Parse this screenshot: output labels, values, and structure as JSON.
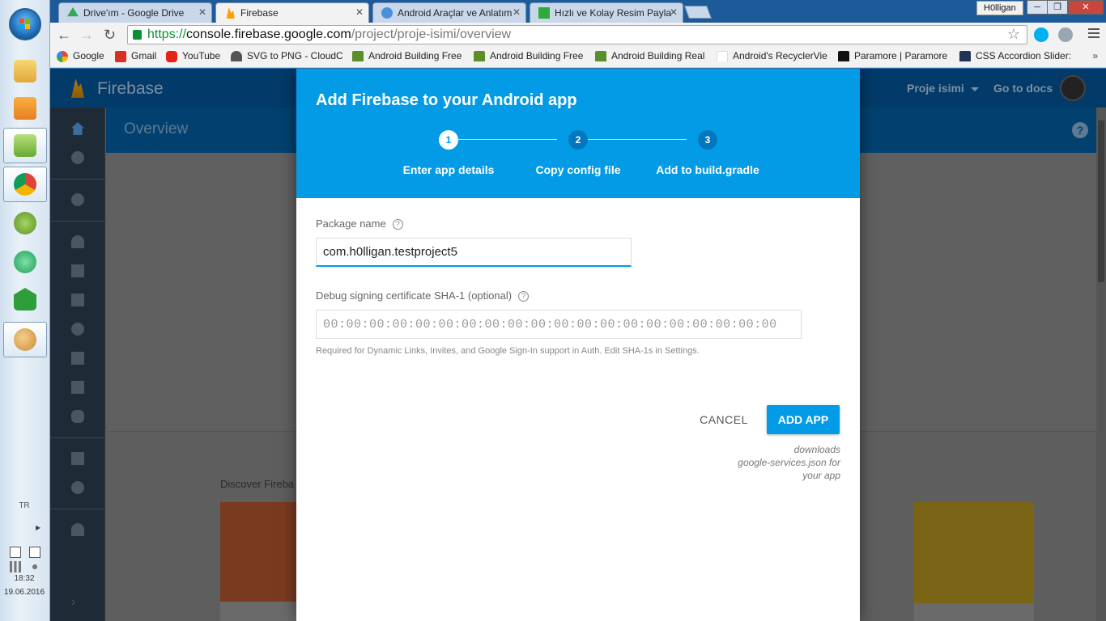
{
  "taskbar": {
    "apps": [
      {
        "name": "file-explorer"
      },
      {
        "name": "media-player"
      },
      {
        "name": "notepad-plus-plus"
      },
      {
        "name": "chrome"
      },
      {
        "name": "android-studio"
      },
      {
        "name": "atom"
      },
      {
        "name": "mapping-app"
      },
      {
        "name": "paint"
      }
    ],
    "language": "TR",
    "clock_time": "18:32",
    "clock_date": "19.06.2016"
  },
  "browser": {
    "profile": "H0lligan",
    "tabs": [
      {
        "label": "Drive'ım - Google Drive",
        "favicon_color": "#34a853"
      },
      {
        "label": "Firebase",
        "favicon_color": "#ffa000"
      },
      {
        "label": "Android Araçlar ve Anlatım",
        "favicon_color": "#4a90d9"
      },
      {
        "label": "Hızlı ve Kolay Resim Payla",
        "favicon_color": "#2eaa3a"
      }
    ],
    "url_scheme": "https://",
    "url_host": "console.firebase.google.com",
    "url_path": "/project/proje-isimi/overview",
    "bookmarks": [
      {
        "label": "Google",
        "color": "#4285f4"
      },
      {
        "label": "Gmail",
        "color": "#d93025"
      },
      {
        "label": "YouTube",
        "color": "#e62117"
      },
      {
        "label": "SVG to PNG - CloudC",
        "color": "#555555"
      },
      {
        "label": "Android Building Free",
        "color": "#5a8f29"
      },
      {
        "label": "Android Building Free",
        "color": "#5a8f29"
      },
      {
        "label": "Android Building Real",
        "color": "#5a8f29"
      },
      {
        "label": "Android's RecyclerVie",
        "color": "#ffffff"
      },
      {
        "label": "Paramore | Paramore",
        "color": "#111111"
      },
      {
        "label": "CSS Accordion Slider:",
        "color": "#223355"
      }
    ],
    "bookmarks_more": "»"
  },
  "firebase": {
    "brand": "Firebase",
    "project": "Proje isimi",
    "docs": "Go to docs",
    "page_title": "Overview",
    "help": "?",
    "discover": "Discover Fireba",
    "nav_icons": [
      "home-icon",
      "settings-icon",
      "analytics-icon",
      "users-icon",
      "database-icon",
      "storage-icon",
      "hosting-icon",
      "remote-config-icon",
      "test-lab-icon",
      "crash-icon",
      "notifications-icon",
      "dynamic-links-icon",
      "admob-icon",
      "expand-icon"
    ]
  },
  "modal": {
    "title": "Add Firebase to your Android app",
    "steps": [
      {
        "number": "1",
        "label": "Enter app details"
      },
      {
        "number": "2",
        "label": "Copy config file"
      },
      {
        "number": "3",
        "label": "Add to build.gradle"
      }
    ],
    "package_label": "Package name",
    "package_value": "com.h0lligan.testproject5",
    "sha_label": "Debug signing certificate SHA-1 (optional)",
    "sha_placeholder": "00:00:00:00:00:00:00:00:00:00:00:00:00:00:00:00:00:00:00:00",
    "sha_hint": "Required for Dynamic Links, Invites, and Google Sign-In support in Auth. Edit SHA-1s in Settings.",
    "cancel": "CANCEL",
    "add": "ADD APP",
    "note_line1": "downloads",
    "note_line2": "google-services.json for",
    "note_line3": "your app"
  }
}
